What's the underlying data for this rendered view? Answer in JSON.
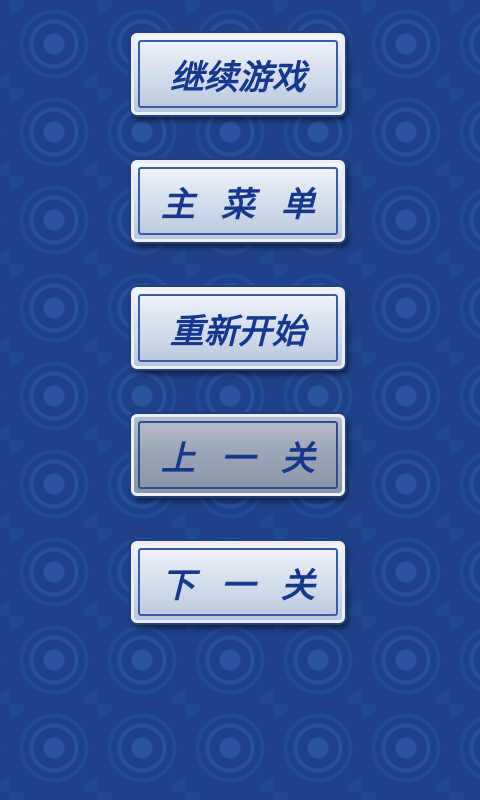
{
  "menu": {
    "continue_label": "继续游戏",
    "main_menu_label": "主菜单",
    "restart_label": "重新开始",
    "prev_level_label": "上一关",
    "next_level_label": "下一关"
  },
  "colors": {
    "background": "#1e4189",
    "button_text": "#16388c",
    "button_face": "#d7e0ee",
    "button_pressed": "#9aa4b6"
  }
}
